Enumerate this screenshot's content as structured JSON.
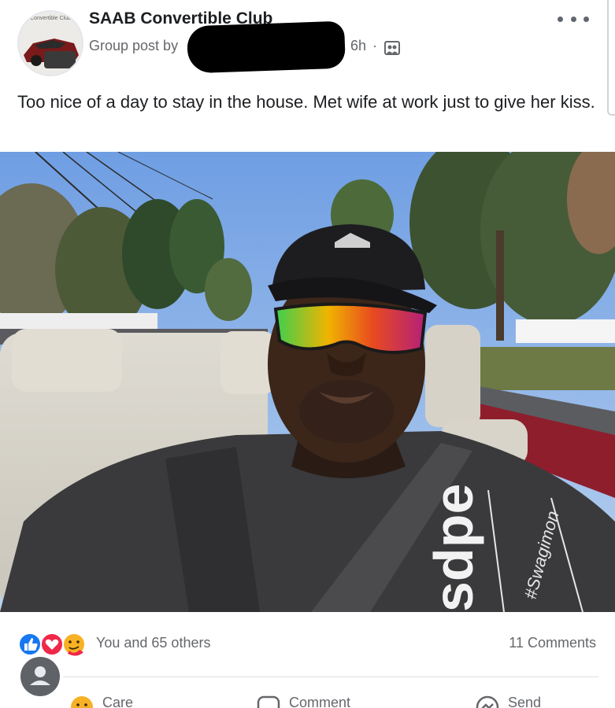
{
  "post": {
    "group_avatar_caption": "Convertible Club",
    "group_name": "SAAB Convertible Club",
    "posted_by_prefix": "Group post by",
    "time": "6h",
    "separator": "·",
    "audience_icon": "group-photo-icon",
    "text": "Too nice of a day to stay in the house. Met wife at work just to give her kiss."
  },
  "photo": {
    "cap_brand": "adidas",
    "shirt_text": "sdpe",
    "shirt_script": "#Swagimon"
  },
  "engagement": {
    "reaction_icons": [
      "like-icon",
      "love-icon",
      "care-icon"
    ],
    "summary": "You and 65 others",
    "comments": "11 Comments"
  },
  "actions": [
    {
      "icon": "care-icon",
      "label": "Care"
    },
    {
      "icon": "comment-icon",
      "label": "Comment"
    },
    {
      "icon": "send-icon",
      "label": "Send"
    }
  ],
  "colors": {
    "like": "#1877f2",
    "love": "#f02849",
    "care": "#f7b125",
    "muted_text": "#65676b"
  }
}
